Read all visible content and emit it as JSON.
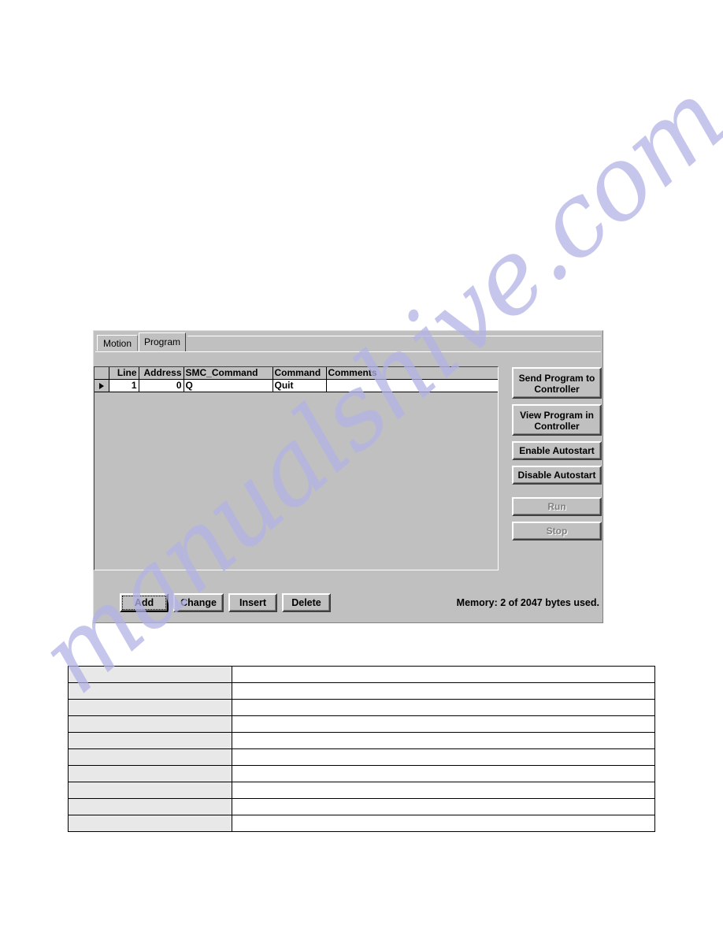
{
  "watermark": {
    "text": "manualshive.com"
  },
  "app": {
    "tabs": [
      {
        "label": "Motion",
        "active": false
      },
      {
        "label": "Program",
        "active": true
      }
    ],
    "grid": {
      "columns": [
        "",
        "Line",
        "Address",
        "SMC_Command",
        "Command",
        "Comments"
      ],
      "rows": [
        {
          "marker": "row-selector-arrow",
          "line": "1",
          "address": "0",
          "smc_command": "Q",
          "command": "Quit",
          "comments": ""
        }
      ]
    },
    "side_buttons": [
      {
        "label": "Send Program to Controller",
        "enabled": true,
        "size": "tall"
      },
      {
        "label": "View Program in Controller",
        "enabled": true,
        "size": "tall"
      },
      {
        "label": "Enable Autostart",
        "enabled": true,
        "size": "short"
      },
      {
        "label": "Disable Autostart",
        "enabled": true,
        "size": "short"
      },
      {
        "label": "Run",
        "enabled": false,
        "size": "short"
      },
      {
        "label": "Stop",
        "enabled": false,
        "size": "short"
      }
    ],
    "toolbar": {
      "add_label": "Add",
      "change_label": "Change",
      "insert_label": "Insert",
      "delete_label": "Delete"
    },
    "status": {
      "memory_text": "Memory: 2 of 2047 bytes used."
    }
  },
  "doc_table": {
    "row_count": 10,
    "rows": [
      {
        "label": "",
        "value": ""
      },
      {
        "label": "",
        "value": ""
      },
      {
        "label": "",
        "value": ""
      },
      {
        "label": "",
        "value": ""
      },
      {
        "label": "",
        "value": ""
      },
      {
        "label": "",
        "value": ""
      },
      {
        "label": "",
        "value": ""
      },
      {
        "label": "",
        "value": ""
      },
      {
        "label": "",
        "value": ""
      },
      {
        "label": "",
        "value": ""
      }
    ]
  },
  "colors": {
    "window_face": "#c0c0c0",
    "grid_cell": "#ffffff",
    "disabled_text": "#808080",
    "watermark": "#b3b3e6",
    "doc_label_cell": "#e8e8e8"
  }
}
